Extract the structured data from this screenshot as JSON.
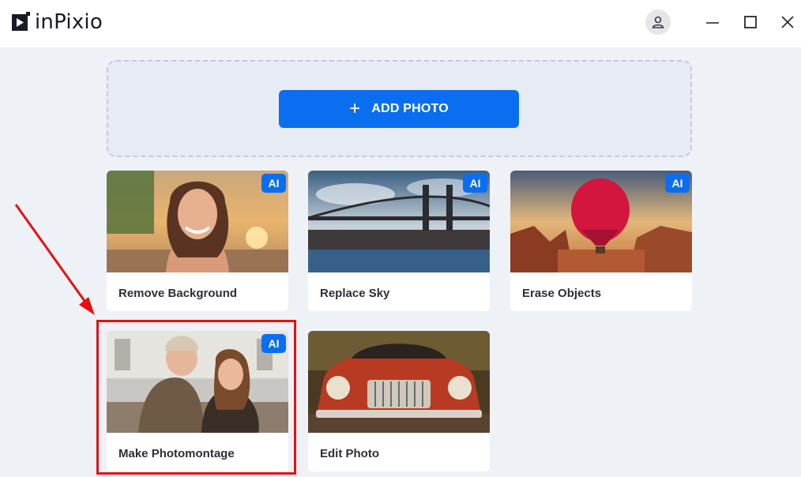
{
  "app": {
    "title": "inPixio"
  },
  "header": {
    "account_icon": "user-icon",
    "minimize_icon": "minimize-icon",
    "maximize_icon": "maximize-icon",
    "close_icon": "close-icon"
  },
  "dropzone": {
    "add_label": "ADD PHOTO",
    "add_icon": "plus-icon"
  },
  "cards": [
    {
      "label": "Remove Background",
      "badge": "AI"
    },
    {
      "label": "Replace Sky",
      "badge": "AI"
    },
    {
      "label": "Erase Objects",
      "badge": "AI"
    },
    {
      "label": "Make Photomontage",
      "badge": "AI"
    },
    {
      "label": "Edit Photo"
    }
  ],
  "colors": {
    "accent": "#0a6ef0",
    "annotation": "#e3120f",
    "background": "#eef1f6"
  }
}
